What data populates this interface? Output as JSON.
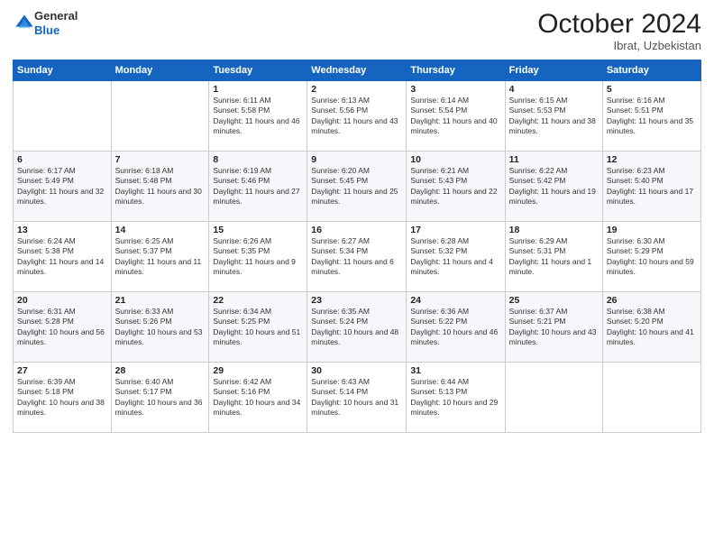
{
  "logo": {
    "line1": "General",
    "line2": "Blue"
  },
  "header": {
    "month": "October 2024",
    "location": "Ibrat, Uzbekistan"
  },
  "weekdays": [
    "Sunday",
    "Monday",
    "Tuesday",
    "Wednesday",
    "Thursday",
    "Friday",
    "Saturday"
  ],
  "weeks": [
    [
      {
        "day": "",
        "sunrise": "",
        "sunset": "",
        "daylight": ""
      },
      {
        "day": "",
        "sunrise": "",
        "sunset": "",
        "daylight": ""
      },
      {
        "day": "1",
        "sunrise": "Sunrise: 6:11 AM",
        "sunset": "Sunset: 5:58 PM",
        "daylight": "Daylight: 11 hours and 46 minutes."
      },
      {
        "day": "2",
        "sunrise": "Sunrise: 6:13 AM",
        "sunset": "Sunset: 5:56 PM",
        "daylight": "Daylight: 11 hours and 43 minutes."
      },
      {
        "day": "3",
        "sunrise": "Sunrise: 6:14 AM",
        "sunset": "Sunset: 5:54 PM",
        "daylight": "Daylight: 11 hours and 40 minutes."
      },
      {
        "day": "4",
        "sunrise": "Sunrise: 6:15 AM",
        "sunset": "Sunset: 5:53 PM",
        "daylight": "Daylight: 11 hours and 38 minutes."
      },
      {
        "day": "5",
        "sunrise": "Sunrise: 6:16 AM",
        "sunset": "Sunset: 5:51 PM",
        "daylight": "Daylight: 11 hours and 35 minutes."
      }
    ],
    [
      {
        "day": "6",
        "sunrise": "Sunrise: 6:17 AM",
        "sunset": "Sunset: 5:49 PM",
        "daylight": "Daylight: 11 hours and 32 minutes."
      },
      {
        "day": "7",
        "sunrise": "Sunrise: 6:18 AM",
        "sunset": "Sunset: 5:48 PM",
        "daylight": "Daylight: 11 hours and 30 minutes."
      },
      {
        "day": "8",
        "sunrise": "Sunrise: 6:19 AM",
        "sunset": "Sunset: 5:46 PM",
        "daylight": "Daylight: 11 hours and 27 minutes."
      },
      {
        "day": "9",
        "sunrise": "Sunrise: 6:20 AM",
        "sunset": "Sunset: 5:45 PM",
        "daylight": "Daylight: 11 hours and 25 minutes."
      },
      {
        "day": "10",
        "sunrise": "Sunrise: 6:21 AM",
        "sunset": "Sunset: 5:43 PM",
        "daylight": "Daylight: 11 hours and 22 minutes."
      },
      {
        "day": "11",
        "sunrise": "Sunrise: 6:22 AM",
        "sunset": "Sunset: 5:42 PM",
        "daylight": "Daylight: 11 hours and 19 minutes."
      },
      {
        "day": "12",
        "sunrise": "Sunrise: 6:23 AM",
        "sunset": "Sunset: 5:40 PM",
        "daylight": "Daylight: 11 hours and 17 minutes."
      }
    ],
    [
      {
        "day": "13",
        "sunrise": "Sunrise: 6:24 AM",
        "sunset": "Sunset: 5:38 PM",
        "daylight": "Daylight: 11 hours and 14 minutes."
      },
      {
        "day": "14",
        "sunrise": "Sunrise: 6:25 AM",
        "sunset": "Sunset: 5:37 PM",
        "daylight": "Daylight: 11 hours and 11 minutes."
      },
      {
        "day": "15",
        "sunrise": "Sunrise: 6:26 AM",
        "sunset": "Sunset: 5:35 PM",
        "daylight": "Daylight: 11 hours and 9 minutes."
      },
      {
        "day": "16",
        "sunrise": "Sunrise: 6:27 AM",
        "sunset": "Sunset: 5:34 PM",
        "daylight": "Daylight: 11 hours and 6 minutes."
      },
      {
        "day": "17",
        "sunrise": "Sunrise: 6:28 AM",
        "sunset": "Sunset: 5:32 PM",
        "daylight": "Daylight: 11 hours and 4 minutes."
      },
      {
        "day": "18",
        "sunrise": "Sunrise: 6:29 AM",
        "sunset": "Sunset: 5:31 PM",
        "daylight": "Daylight: 11 hours and 1 minute."
      },
      {
        "day": "19",
        "sunrise": "Sunrise: 6:30 AM",
        "sunset": "Sunset: 5:29 PM",
        "daylight": "Daylight: 10 hours and 59 minutes."
      }
    ],
    [
      {
        "day": "20",
        "sunrise": "Sunrise: 6:31 AM",
        "sunset": "Sunset: 5:28 PM",
        "daylight": "Daylight: 10 hours and 56 minutes."
      },
      {
        "day": "21",
        "sunrise": "Sunrise: 6:33 AM",
        "sunset": "Sunset: 5:26 PM",
        "daylight": "Daylight: 10 hours and 53 minutes."
      },
      {
        "day": "22",
        "sunrise": "Sunrise: 6:34 AM",
        "sunset": "Sunset: 5:25 PM",
        "daylight": "Daylight: 10 hours and 51 minutes."
      },
      {
        "day": "23",
        "sunrise": "Sunrise: 6:35 AM",
        "sunset": "Sunset: 5:24 PM",
        "daylight": "Daylight: 10 hours and 48 minutes."
      },
      {
        "day": "24",
        "sunrise": "Sunrise: 6:36 AM",
        "sunset": "Sunset: 5:22 PM",
        "daylight": "Daylight: 10 hours and 46 minutes."
      },
      {
        "day": "25",
        "sunrise": "Sunrise: 6:37 AM",
        "sunset": "Sunset: 5:21 PM",
        "daylight": "Daylight: 10 hours and 43 minutes."
      },
      {
        "day": "26",
        "sunrise": "Sunrise: 6:38 AM",
        "sunset": "Sunset: 5:20 PM",
        "daylight": "Daylight: 10 hours and 41 minutes."
      }
    ],
    [
      {
        "day": "27",
        "sunrise": "Sunrise: 6:39 AM",
        "sunset": "Sunset: 5:18 PM",
        "daylight": "Daylight: 10 hours and 38 minutes."
      },
      {
        "day": "28",
        "sunrise": "Sunrise: 6:40 AM",
        "sunset": "Sunset: 5:17 PM",
        "daylight": "Daylight: 10 hours and 36 minutes."
      },
      {
        "day": "29",
        "sunrise": "Sunrise: 6:42 AM",
        "sunset": "Sunset: 5:16 PM",
        "daylight": "Daylight: 10 hours and 34 minutes."
      },
      {
        "day": "30",
        "sunrise": "Sunrise: 6:43 AM",
        "sunset": "Sunset: 5:14 PM",
        "daylight": "Daylight: 10 hours and 31 minutes."
      },
      {
        "day": "31",
        "sunrise": "Sunrise: 6:44 AM",
        "sunset": "Sunset: 5:13 PM",
        "daylight": "Daylight: 10 hours and 29 minutes."
      },
      {
        "day": "",
        "sunrise": "",
        "sunset": "",
        "daylight": ""
      },
      {
        "day": "",
        "sunrise": "",
        "sunset": "",
        "daylight": ""
      }
    ]
  ]
}
